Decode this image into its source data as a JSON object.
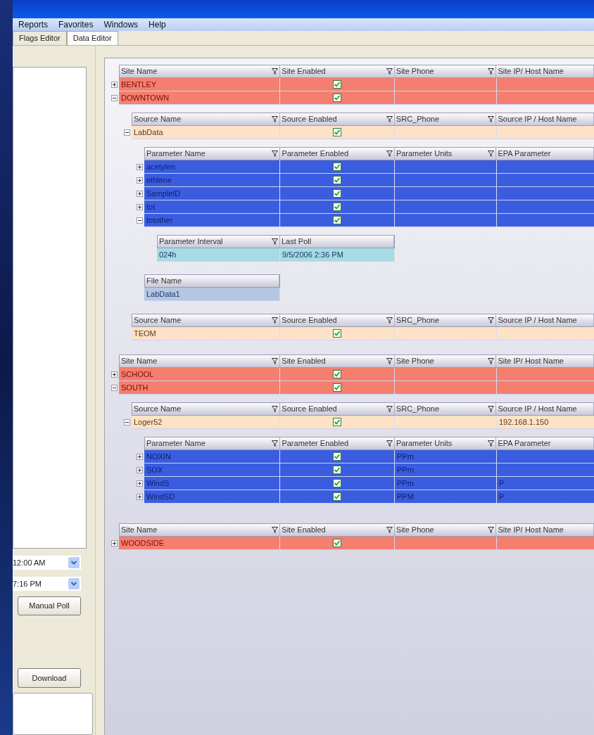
{
  "menu": [
    {
      "label": "Reports"
    },
    {
      "label": "Favorites"
    },
    {
      "label": "Windows"
    },
    {
      "label": "Help"
    }
  ],
  "tabs": [
    {
      "label": "Flags Editor",
      "selected": false
    },
    {
      "label": "Data Editor",
      "selected": true
    }
  ],
  "left_panel": {
    "times": [
      "12:00 AM",
      "7:16 PM"
    ],
    "buttons": [
      "Manual Poll",
      "Download"
    ]
  },
  "grid": {
    "bands": [
      {
        "kind": "site",
        "columns": [
          {
            "label": "Site Name",
            "kind": "text"
          },
          {
            "label": "Site Enabled",
            "kind": "check"
          },
          {
            "label": "Site Phone",
            "kind": "text"
          },
          {
            "label": "Site IP/ Host Name",
            "kind": "text"
          }
        ],
        "rows": [
          {
            "expanded": false,
            "cells": [
              {
                "text": "BENTLEY"
              },
              {
                "checked": true
              },
              {},
              {}
            ]
          },
          {
            "expanded": true,
            "cells": [
              {
                "text": "DOWNTOWN"
              },
              {
                "checked": true
              },
              {},
              {}
            ],
            "children": [
              {
                "kind": "source",
                "columns": [
                  {
                    "label": "Source Name",
                    "kind": "text"
                  },
                  {
                    "label": "Source Enabled",
                    "kind": "check"
                  },
                  {
                    "label": "SRC_Phone",
                    "kind": "text"
                  },
                  {
                    "label": "Source IP / Host Name",
                    "kind": "text"
                  }
                ],
                "rows": [
                  {
                    "expanded": true,
                    "cells": [
                      {
                        "text": "LabData"
                      },
                      {
                        "checked": true
                      },
                      {},
                      {}
                    ],
                    "children": [
                      {
                        "kind": "parameter",
                        "columns": [
                          {
                            "label": "Parameter Name",
                            "kind": "text"
                          },
                          {
                            "label": "Parameter Enabled",
                            "kind": "check"
                          },
                          {
                            "label": "Parameter Units",
                            "kind": "text"
                          },
                          {
                            "label": "EPA Parameter",
                            "kind": "text"
                          }
                        ],
                        "rows": [
                          {
                            "expanded": false,
                            "cells": [
                              {
                                "text": "acetylen"
                              },
                              {
                                "checked": true
                              },
                              {},
                              {}
                            ]
                          },
                          {
                            "expanded": false,
                            "cells": [
                              {
                                "text": "ethlene"
                              },
                              {
                                "checked": true
                              },
                              {},
                              {}
                            ]
                          },
                          {
                            "expanded": false,
                            "cells": [
                              {
                                "text": "SampleID"
                              },
                              {
                                "checked": true
                              },
                              {},
                              {}
                            ]
                          },
                          {
                            "expanded": false,
                            "cells": [
                              {
                                "text": "tot"
                              },
                              {
                                "checked": true
                              },
                              {},
                              {}
                            ]
                          },
                          {
                            "expanded": true,
                            "cells": [
                              {
                                "text": "totother"
                              },
                              {
                                "checked": true
                              },
                              {},
                              {}
                            ],
                            "children": [
                              {
                                "kind": "interval",
                                "columns": [
                                  {
                                    "label": "Parameter Interval",
                                    "kind": "text"
                                  },
                                  {
                                    "label": "Last Poll",
                                    "kind": "text"
                                  }
                                ],
                                "rows": [
                                  {
                                    "cells": [
                                      {
                                        "text": "024h"
                                      },
                                      {
                                        "text": "9/5/2006 2:36 PM"
                                      }
                                    ]
                                  }
                                ]
                              }
                            ]
                          }
                        ]
                      },
                      {
                        "kind": "file",
                        "columns": [
                          {
                            "label": "File Name",
                            "kind": "text"
                          }
                        ],
                        "rows": [
                          {
                            "cells": [
                              {
                                "text": "LabData1"
                              }
                            ]
                          }
                        ]
                      }
                    ]
                  }
                ]
              },
              {
                "kind": "source",
                "columns": [
                  {
                    "label": "Source Name",
                    "kind": "text"
                  },
                  {
                    "label": "Source Enabled",
                    "kind": "check"
                  },
                  {
                    "label": "SRC_Phone",
                    "kind": "text"
                  },
                  {
                    "label": "Source IP / Host Name",
                    "kind": "text"
                  }
                ],
                "rows": [
                  {
                    "cells": [
                      {
                        "text": "TEOM"
                      },
                      {
                        "checked": true
                      },
                      {},
                      {}
                    ]
                  }
                ]
              }
            ]
          }
        ]
      },
      {
        "kind": "site",
        "columns": [
          {
            "label": "Site Name",
            "kind": "text"
          },
          {
            "label": "Site Enabled",
            "kind": "check"
          },
          {
            "label": "Site Phone",
            "kind": "text"
          },
          {
            "label": "Site IP/ Host Name",
            "kind": "text"
          }
        ],
        "rows": [
          {
            "expanded": false,
            "cells": [
              {
                "text": "SCHOOL"
              },
              {
                "checked": true
              },
              {},
              {}
            ]
          },
          {
            "expanded": true,
            "cells": [
              {
                "text": "SOUTH"
              },
              {
                "checked": true
              },
              {},
              {}
            ],
            "children": [
              {
                "kind": "source",
                "columns": [
                  {
                    "label": "Source Name",
                    "kind": "text"
                  },
                  {
                    "label": "Source Enabled",
                    "kind": "check"
                  },
                  {
                    "label": "SRC_Phone",
                    "kind": "text"
                  },
                  {
                    "label": "Source IP / Host Name",
                    "kind": "text"
                  }
                ],
                "rows": [
                  {
                    "expanded": true,
                    "cells": [
                      {
                        "text": "Loger52"
                      },
                      {
                        "checked": true
                      },
                      {},
                      {
                        "text": "192.168.1.150"
                      }
                    ],
                    "children": [
                      {
                        "kind": "parameter",
                        "columns": [
                          {
                            "label": "Parameter Name",
                            "kind": "text"
                          },
                          {
                            "label": "Parameter Enabled",
                            "kind": "check"
                          },
                          {
                            "label": "Parameter Units",
                            "kind": "text"
                          },
                          {
                            "label": "EPA Parameter",
                            "kind": "text"
                          }
                        ],
                        "rows": [
                          {
                            "expanded": false,
                            "cells": [
                              {
                                "text": "NOXIN"
                              },
                              {
                                "checked": true
                              },
                              {
                                "text": "PPm"
                              },
                              {}
                            ]
                          },
                          {
                            "expanded": false,
                            "cells": [
                              {
                                "text": "SOX"
                              },
                              {
                                "checked": true
                              },
                              {
                                "text": "PPm"
                              },
                              {}
                            ]
                          },
                          {
                            "expanded": false,
                            "cells": [
                              {
                                "text": "WindS"
                              },
                              {
                                "checked": true
                              },
                              {
                                "text": "PPm"
                              },
                              {
                                "text": "P"
                              }
                            ]
                          },
                          {
                            "expanded": false,
                            "cells": [
                              {
                                "text": "WindSD"
                              },
                              {
                                "checked": true
                              },
                              {
                                "text": "PPM"
                              },
                              {
                                "text": "P"
                              }
                            ]
                          }
                        ]
                      }
                    ]
                  }
                ]
              }
            ]
          }
        ]
      },
      {
        "kind": "site",
        "columns": [
          {
            "label": "Site Name",
            "kind": "text"
          },
          {
            "label": "Site Enabled",
            "kind": "check"
          },
          {
            "label": "Site Phone",
            "kind": "text"
          },
          {
            "label": "Site IP/ Host Name",
            "kind": "text"
          }
        ],
        "rows": [
          {
            "expanded": false,
            "cells": [
              {
                "text": "WOODSIDE"
              },
              {
                "checked": true
              },
              {},
              {}
            ]
          }
        ]
      }
    ]
  }
}
